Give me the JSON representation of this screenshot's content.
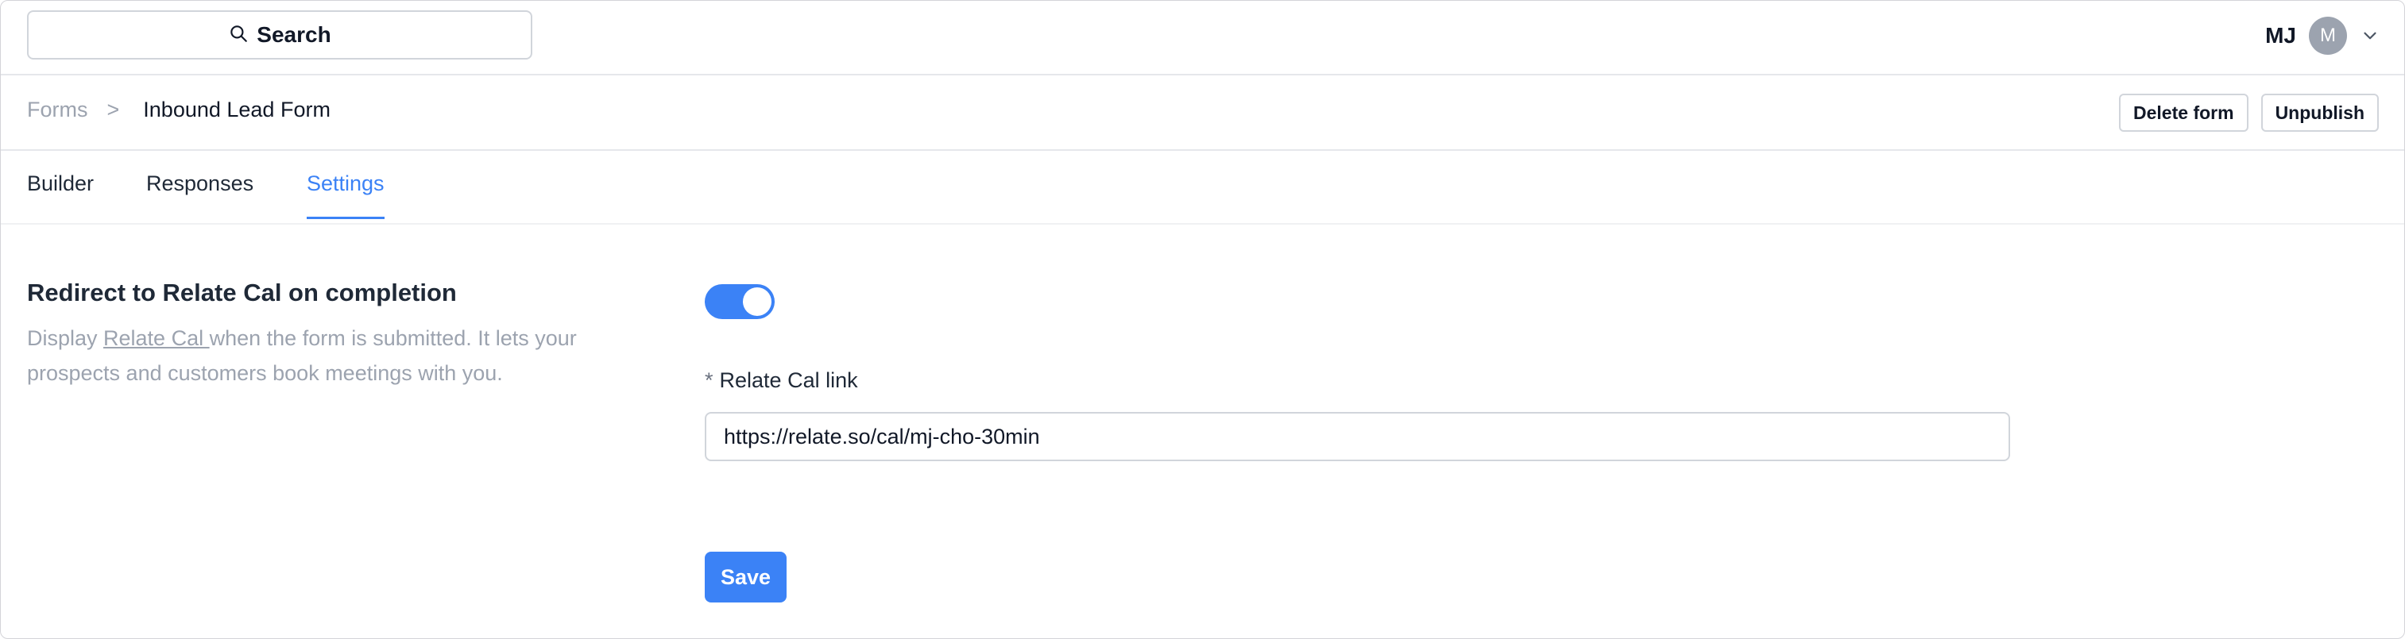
{
  "header": {
    "search_label": "Search",
    "user_initials": "MJ",
    "avatar_letter": "M"
  },
  "breadcrumb": {
    "parent": "Forms",
    "separator": ">",
    "current": "Inbound Lead Form"
  },
  "actions": {
    "delete_label": "Delete form",
    "unpublish_label": "Unpublish"
  },
  "tabs": [
    {
      "label": "Builder",
      "active": false
    },
    {
      "label": "Responses",
      "active": false
    },
    {
      "label": "Settings",
      "active": true
    }
  ],
  "settings": {
    "title": "Redirect to Relate Cal on completion",
    "desc_prefix": "Display ",
    "desc_link": "Relate Cal ",
    "desc_suffix": "when the form is submitted. It lets your prospects and customers book meetings with you.",
    "toggle_on": true,
    "required_mark": "*",
    "field_label": "Relate Cal link",
    "field_value": "https://relate.so/cal/mj-cho-30min",
    "save_label": "Save"
  },
  "colors": {
    "accent": "#3b82f6",
    "muted_text": "#9ca3af",
    "border": "#d1d5db"
  },
  "icons": {
    "search": "search-icon",
    "chevron": "chevron-down-icon"
  }
}
